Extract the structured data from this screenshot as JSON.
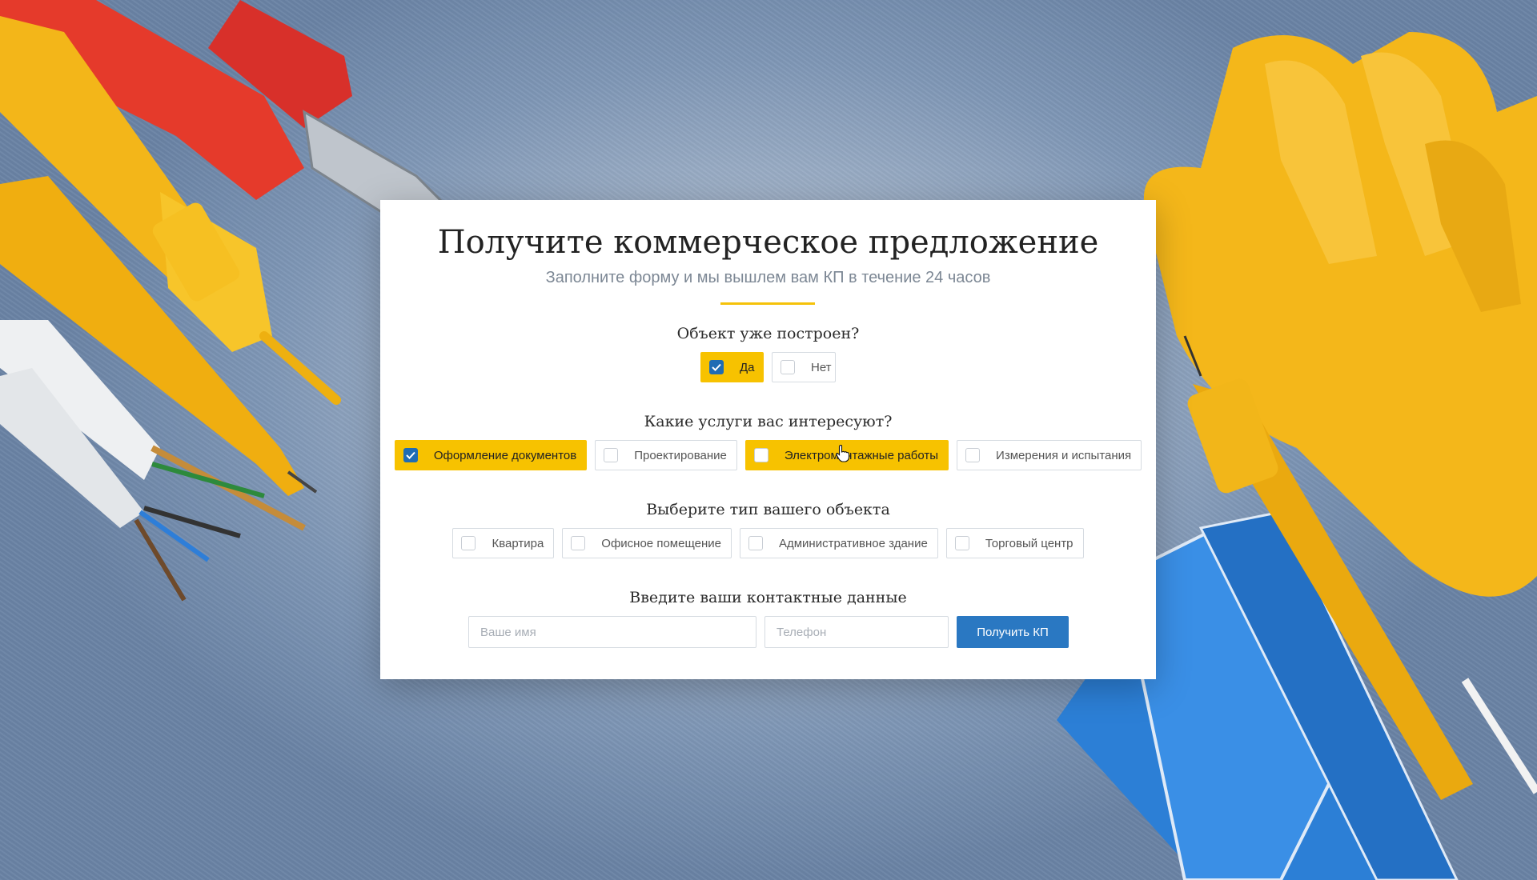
{
  "form": {
    "title": "Получите коммерческое предложение",
    "subtitle": "Заполните форму и мы вышлем вам КП в течение 24 часов"
  },
  "section_built": {
    "label": "Объект уже построен?",
    "options": [
      {
        "label": "Да",
        "checked": true
      },
      {
        "label": "Нет",
        "checked": false
      }
    ]
  },
  "section_services": {
    "label": "Какие услуги вас интересуют?",
    "options": [
      {
        "label": "Оформление документов",
        "checked": true
      },
      {
        "label": "Проектирование",
        "checked": false
      },
      {
        "label": "Электромонтажные работы",
        "checked": false
      },
      {
        "label": "Измерения и испытания",
        "checked": false
      }
    ]
  },
  "section_object": {
    "label": "Выберите тип вашего объекта",
    "options": [
      {
        "label": "Квартира",
        "checked": false
      },
      {
        "label": "Офисное помещение",
        "checked": false
      },
      {
        "label": "Административное здание",
        "checked": false
      },
      {
        "label": "Торговый центр",
        "checked": false
      }
    ]
  },
  "section_contacts": {
    "label": "Введите ваши контактные данные",
    "name_placeholder": "Ваше имя",
    "phone_placeholder": "Телефон",
    "submit_label": "Получить КП"
  },
  "colors": {
    "accent_yellow": "#f7c200",
    "checkbox_blue": "#1f6cb4",
    "button_blue": "#2a78c2"
  },
  "icons": [
    "checkmark-icon",
    "hand-cursor-icon"
  ]
}
